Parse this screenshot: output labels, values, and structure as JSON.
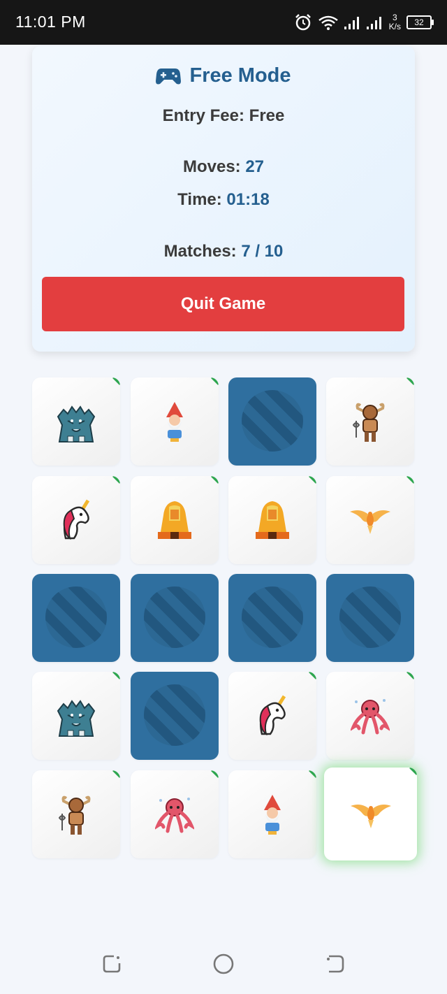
{
  "status_bar": {
    "time": "11:01 PM",
    "speed_value": "3",
    "speed_unit": "K/s",
    "battery": "32"
  },
  "header": {
    "title": "Free Mode",
    "entry_fee_label": "Entry Fee:",
    "entry_fee_value": "Free",
    "moves_label": "Moves:",
    "moves_value": "27",
    "time_label": "Time:",
    "time_value": "01:18",
    "matches_label": "Matches:",
    "matches_value": "7 / 10"
  },
  "quit_button_label": "Quit Game",
  "colors": {
    "accent": "#245f8f",
    "quit": "#e33e3f",
    "card_back": "#2f6f9f",
    "match_marker": "#2ea64f"
  },
  "board": {
    "rows": 5,
    "cols": 4,
    "tiles": [
      {
        "icon": "werewolf-icon",
        "state": "matched"
      },
      {
        "icon": "gnome-icon",
        "state": "matched"
      },
      {
        "icon": "card-back",
        "state": "hidden"
      },
      {
        "icon": "minotaur-icon",
        "state": "matched"
      },
      {
        "icon": "unicorn-icon",
        "state": "matched"
      },
      {
        "icon": "sphinx-icon",
        "state": "matched"
      },
      {
        "icon": "sphinx-icon",
        "state": "matched"
      },
      {
        "icon": "phoenix-icon",
        "state": "matched"
      },
      {
        "icon": "card-back",
        "state": "hidden"
      },
      {
        "icon": "card-back",
        "state": "hidden"
      },
      {
        "icon": "card-back",
        "state": "hidden"
      },
      {
        "icon": "card-back",
        "state": "hidden"
      },
      {
        "icon": "werewolf-icon",
        "state": "matched"
      },
      {
        "icon": "card-back",
        "state": "hidden"
      },
      {
        "icon": "unicorn-icon",
        "state": "matched"
      },
      {
        "icon": "kraken-icon",
        "state": "matched"
      },
      {
        "icon": "minotaur-icon",
        "state": "matched"
      },
      {
        "icon": "kraken-icon",
        "state": "matched"
      },
      {
        "icon": "gnome-icon",
        "state": "matched"
      },
      {
        "icon": "phoenix-icon",
        "state": "matched-active"
      }
    ]
  },
  "nav": [
    "recents-button",
    "home-button",
    "back-button"
  ]
}
